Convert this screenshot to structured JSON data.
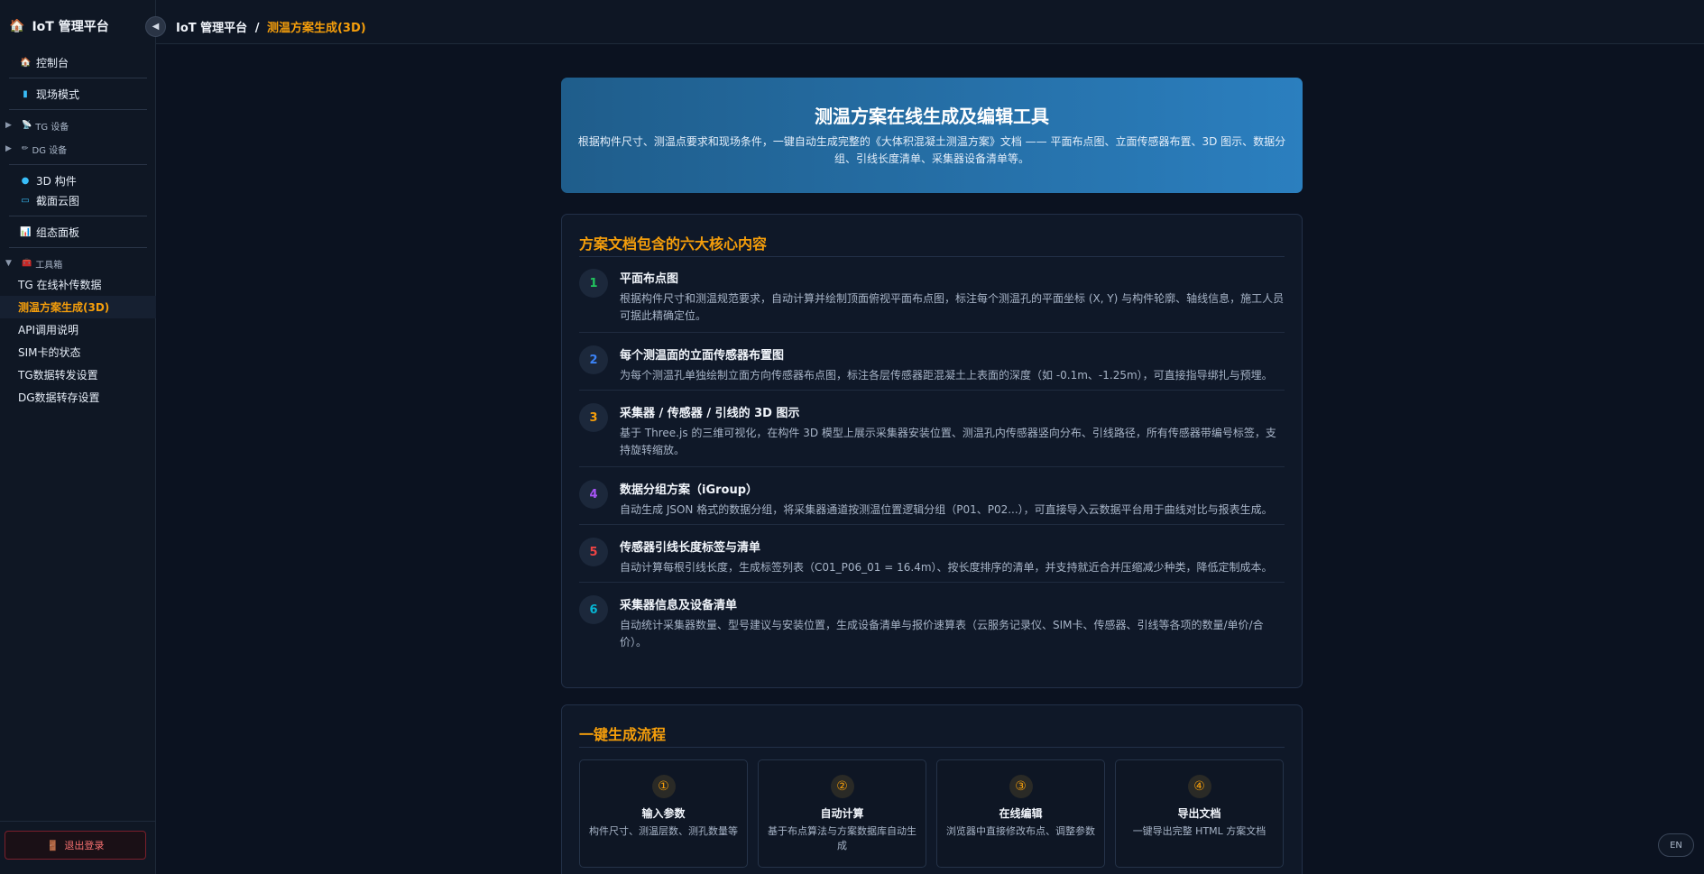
{
  "brand": {
    "title": "IoT 管理平台",
    "icon": "home-icon"
  },
  "sidebar": {
    "top_items": [
      {
        "label": "控制台",
        "icon": "home-icon"
      },
      {
        "label": "现场模式",
        "icon": "bar-icon"
      }
    ],
    "groups": [
      {
        "label": "TG 设备",
        "icon": "satellite-icon"
      },
      {
        "label": "DG 设备",
        "icon": "pen-icon"
      }
    ],
    "mid_items": [
      {
        "label": "3D 构件",
        "icon": "dot-icon"
      },
      {
        "label": "截面云图",
        "icon": "map-icon"
      }
    ],
    "panel_item": {
      "label": "组态面板",
      "icon": "chart-icon"
    },
    "toolbox": {
      "label": "工具箱",
      "icon": "toolbox-icon",
      "items": [
        {
          "label": "TG 在线补传数据"
        },
        {
          "label": "测温方案生成(3D)"
        },
        {
          "label": "API调用说明"
        },
        {
          "label": "SIM卡的状态"
        },
        {
          "label": "TG数据转发设置"
        },
        {
          "label": "DG数据转存设置"
        }
      ]
    },
    "logout_label": "退出登录"
  },
  "topbar": {
    "root": "IoT 管理平台",
    "separator": "/",
    "current": "测温方案生成(3D)"
  },
  "hero": {
    "title": "测温方案在线生成及编辑工具",
    "desc": "根据构件尺寸、测温点要求和现场条件，一键自动生成完整的《大体积混凝土测温方案》文档 —— 平面布点图、立面传感器布置、3D 图示、数据分组、引线长度清单、采集器设备清单等。"
  },
  "features": {
    "title": "方案文档包含的六大核心内容",
    "items": [
      {
        "num": "1",
        "color": "#22c55e",
        "title": "平面布点图",
        "desc": "根据构件尺寸和测温规范要求，自动计算并绘制顶面俯视平面布点图，标注每个测温孔的平面坐标 (X, Y) 与构件轮廓、轴线信息，施工人员可据此精确定位。"
      },
      {
        "num": "2",
        "color": "#3b82f6",
        "title": "每个测温面的立面传感器布置图",
        "desc": "为每个测温孔单独绘制立面方向传感器布点图，标注各层传感器距混凝土上表面的深度（如 -0.1m、-1.25m），可直接指导绑扎与预埋。"
      },
      {
        "num": "3",
        "color": "#f59e0b",
        "title": "采集器 / 传感器 / 引线的 3D 图示",
        "desc": "基于 Three.js 的三维可视化，在构件 3D 模型上展示采集器安装位置、测温孔内传感器竖向分布、引线路径，所有传感器带编号标签，支持旋转缩放。"
      },
      {
        "num": "4",
        "color": "#a855f7",
        "title": "数据分组方案（iGroup）",
        "desc": "自动生成 JSON 格式的数据分组，将采集器通道按测温位置逻辑分组（P01、P02...），可直接导入云数据平台用于曲线对比与报表生成。"
      },
      {
        "num": "5",
        "color": "#ef4444",
        "title": "传感器引线长度标签与清单",
        "desc": "自动计算每根引线长度，生成标签列表（C01_P06_01 = 16.4m）、按长度排序的清单，并支持就近合并压缩减少种类，降低定制成本。"
      },
      {
        "num": "6",
        "color": "#06b6d4",
        "title": "采集器信息及设备清单",
        "desc": "自动统计采集器数量、型号建议与安装位置，生成设备清单与报价速算表（云服务记录仪、SIM卡、传感器、引线等各项的数量/单价/合价）。"
      }
    ]
  },
  "flow": {
    "title": "一键生成流程",
    "steps": [
      {
        "num": "①",
        "title": "输入参数",
        "desc": "构件尺寸、测温层数、测孔数量等"
      },
      {
        "num": "②",
        "title": "自动计算",
        "desc": "基于布点算法与方案数据库自动生成"
      },
      {
        "num": "③",
        "title": "在线编辑",
        "desc": "浏览器中直接修改布点、调整参数"
      },
      {
        "num": "④",
        "title": "导出文档",
        "desc": "一键导出完整 HTML 方案文档"
      }
    ]
  },
  "lang_label": "EN",
  "colors": {
    "accent": "#f59e0b",
    "hero_from": "#1f5d8b",
    "hero_to": "#2b7fbf",
    "logout": "#f87171"
  }
}
